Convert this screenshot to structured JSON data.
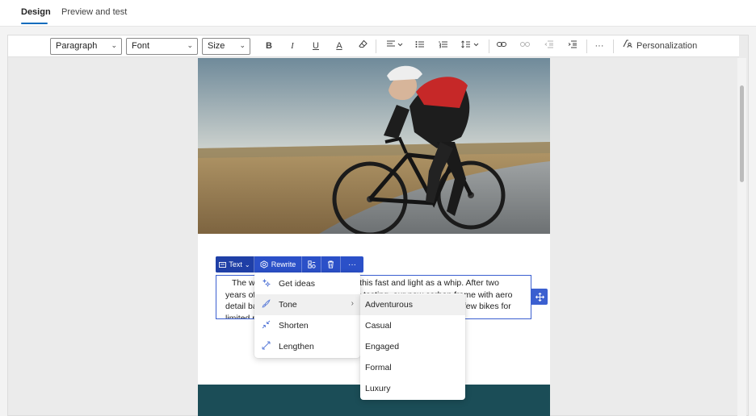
{
  "tabs": [
    {
      "label": "Design",
      "active": true
    },
    {
      "label": "Preview and test",
      "active": false
    }
  ],
  "toolbar": {
    "paragraph_select": "Paragraph",
    "font_select": "Font",
    "size_select": "Size",
    "bold": "B",
    "italic": "I",
    "underline": "U",
    "font_color": "A",
    "more": "···",
    "personalization": "Personalization"
  },
  "block_toolbar": {
    "text_label": "Text",
    "rewrite_label": "Rewrite",
    "more": "···"
  },
  "text_block": {
    "content": "The way you ride has never been this fast and light as a whip. After two years of development and extensive testing, our new carbon frame with aero detail bar is ready to let this one out into the world. We've got a few bikes for limited release and you're welcome to"
  },
  "rewrite_menu": {
    "items": [
      {
        "label": "Get ideas",
        "icon": "sparkle-icon"
      },
      {
        "label": "Tone",
        "icon": "paint-brush-icon",
        "has_submenu": true
      },
      {
        "label": "Shorten",
        "icon": "collapse-arrows-icon"
      },
      {
        "label": "Lengthen",
        "icon": "expand-arrows-icon"
      }
    ]
  },
  "tone_submenu": {
    "items": [
      "Adventurous",
      "Casual",
      "Engaged",
      "Formal",
      "Luxury"
    ]
  },
  "colors": {
    "accent": "#2b50c8",
    "footer_band": "#1b4d57",
    "tab_underline": "#0f6cbd"
  }
}
